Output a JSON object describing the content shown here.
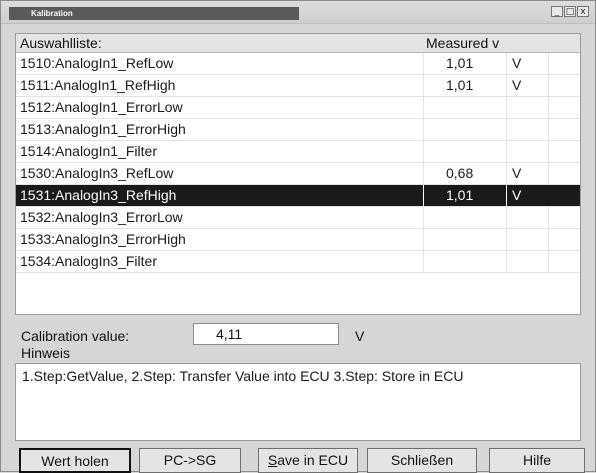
{
  "window": {
    "title": "Kalibration",
    "min_label": "_",
    "max_label": "□",
    "close_label": "x"
  },
  "list": {
    "header_name": "Auswahlliste:",
    "header_measured": "Measured v",
    "rows": [
      {
        "name": "1510:AnalogIn1_RefLow",
        "value": "1,01",
        "flag": "V"
      },
      {
        "name": "1511:AnalogIn1_RefHigh",
        "value": "1,01",
        "flag": "V"
      },
      {
        "name": "1512:AnalogIn1_ErrorLow",
        "value": "",
        "flag": ""
      },
      {
        "name": "1513:AnalogIn1_ErrorHigh",
        "value": "",
        "flag": ""
      },
      {
        "name": "1514:AnalogIn1_Filter",
        "value": "",
        "flag": ""
      },
      {
        "name": "1530:AnalogIn3_RefLow",
        "value": "0,68",
        "flag": "V"
      },
      {
        "name": "1531:AnalogIn3_RefHigh",
        "value": "1,01",
        "flag": "V"
      },
      {
        "name": "1532:AnalogIn3_ErrorLow",
        "value": "",
        "flag": ""
      },
      {
        "name": "1533:AnalogIn3_ErrorHigh",
        "value": "",
        "flag": ""
      },
      {
        "name": "1534:AnalogIn3_Filter",
        "value": "",
        "flag": ""
      }
    ],
    "selected_index": 6
  },
  "calibration": {
    "label": "Calibration value:",
    "value": "4,11",
    "unit": "V"
  },
  "hint": {
    "label": "Hinweis",
    "text": "1.Step:GetValue, 2.Step: Transfer Value into ECU 3.Step: Store in ECU"
  },
  "buttons": {
    "get_value": "Wert holen",
    "pc_to_sg": "PC->SG",
    "save_prefix": "S",
    "save_rest": "ave in ECU",
    "close": "Schließen",
    "help": "Hilfe"
  }
}
